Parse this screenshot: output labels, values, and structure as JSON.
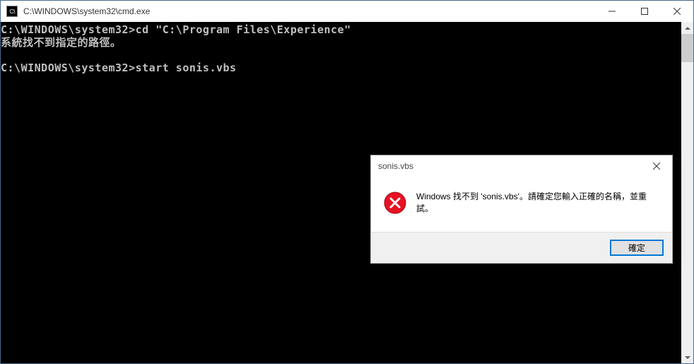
{
  "cmd": {
    "title": "C:\\WINDOWS\\system32\\cmd.exe",
    "icon_label": "C:\\",
    "lines": {
      "l1_prompt": "C:\\WINDOWS\\system32>",
      "l1_cmd": "cd \"C:\\Program Files\\Experience\"",
      "l2": "系統找不到指定的路徑。",
      "l3": "",
      "l4_prompt": "C:\\WINDOWS\\system32>",
      "l4_cmd": "start sonis.vbs"
    }
  },
  "dialog": {
    "title": "sonis.vbs",
    "message": "Windows 找不到 'sonis.vbs'。請確定您輸入正確的名稱，並重試。",
    "ok_label": "確定"
  }
}
